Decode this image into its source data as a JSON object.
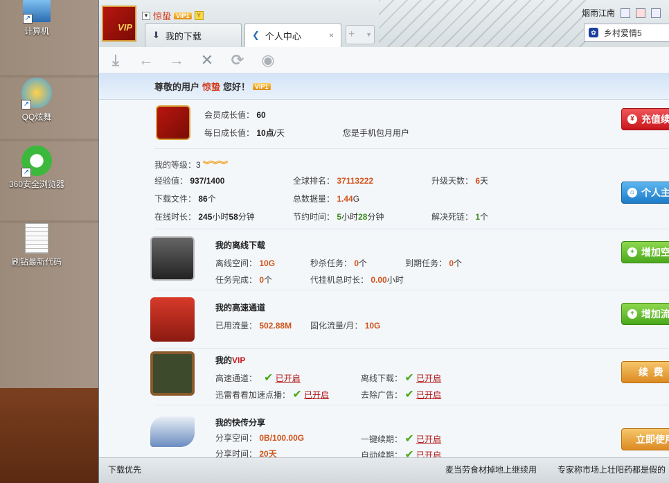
{
  "desktop": {
    "icons": [
      {
        "label": "计算机"
      },
      {
        "label": "QQ炫舞"
      },
      {
        "label": "360安全浏览器"
      },
      {
        "label": "刷钻最新代码"
      }
    ]
  },
  "window": {
    "user": {
      "name": "惊蛰",
      "vip_badge": "VIP1",
      "logo_text": "VIP"
    },
    "tabs": [
      {
        "label": "我的下载"
      },
      {
        "label": "个人中心",
        "close": "×"
      }
    ],
    "new_tab": "+",
    "weather": {
      "city": "烟雨江南",
      "dropdown": "乡村爱情5"
    },
    "toolbar": {
      "icons": [
        "download-icon",
        "back-icon",
        "forward-icon",
        "stop-icon",
        "refresh-icon",
        "eye-icon"
      ]
    },
    "greeting": {
      "prefix": "尊敬的用户",
      "name": "惊蛰",
      "suffix": "您好！",
      "vip": "VIP1"
    },
    "member": {
      "growth_label": "会员成长值：",
      "growth_value": "60",
      "daily_label": "每日成长值：",
      "daily_value": "10",
      "daily_unit_dian": "点",
      "daily_unit": "/天",
      "mobile": "您是手机包月用户",
      "button": "充值续"
    },
    "level": {
      "label": "我的等级：",
      "value": "3",
      "rows": [
        [
          {
            "l": "经验值：",
            "v": "937/1400"
          },
          {
            "l": "全球排名：",
            "v": "37113222"
          },
          {
            "l": "升级天数：",
            "v": "6",
            "u": "天"
          }
        ],
        [
          {
            "l": "下载文件：",
            "v": "86",
            "u": "个"
          },
          {
            "l": "总数据量：",
            "v": "1.44",
            "u": "G"
          }
        ],
        [
          {
            "l": "在线时长：",
            "v": "245",
            "u": "小时",
            "v2": "58",
            "u2": "分钟"
          },
          {
            "l": "节约时间：",
            "v": "5",
            "u": "小时",
            "v2": "28",
            "u2": "分钟"
          },
          {
            "l": "解决死链：",
            "v": "1",
            "u": "个"
          }
        ]
      ],
      "button": "个人主"
    },
    "offline": {
      "title": "我的离线下载",
      "space_label": "离线空间：",
      "space_value": "10G",
      "instant_label": "秒杀任务：",
      "instant_value": "0",
      "instant_unit": "个",
      "expire_label": "到期任务：",
      "expire_value": "0",
      "expire_unit": "个",
      "done_label": "任务完成：",
      "done_value": "0",
      "done_unit": "个",
      "hang_label": "代挂机总时长：",
      "hang_value": "0.00",
      "hang_unit": "小时",
      "button": "增加空"
    },
    "highspeed": {
      "title": "我的高速通道",
      "used_label": "已用流量：",
      "used_value": "502.88M",
      "fixed_label": "固化流量/月：",
      "fixed_value": "10G",
      "button": "增加流"
    },
    "vip": {
      "title_prefix": "我的",
      "title_vip": "VIP",
      "items": [
        {
          "label": "高速通道：",
          "status": "已开启"
        },
        {
          "label": "离线下载：",
          "status": "已开启"
        },
        {
          "label": "迅雷看看加速点播：",
          "status": "已开启"
        },
        {
          "label": "去除广告：",
          "status": "已开启"
        }
      ],
      "button": "续  费"
    },
    "share": {
      "title": "我的快传分享",
      "space_label": "分享空间：",
      "space_value": "0B/100.00G",
      "time_label": "分享时间：",
      "time_value": "20天",
      "renew1_label": "一键续期：",
      "renew1_status": "已开启",
      "renew2_label": "自动续期：",
      "renew2_status": "已开启",
      "button": "立即使用"
    },
    "statusbar": {
      "left": "下载优先",
      "mid": "麦当劳食材掉地上继续用",
      "right": "专家称市场上壮阳药都是假的"
    }
  },
  "colors": {
    "accent_orange": "#d0541c",
    "accent_red": "#d43a1a",
    "green": "#4aa81c"
  }
}
